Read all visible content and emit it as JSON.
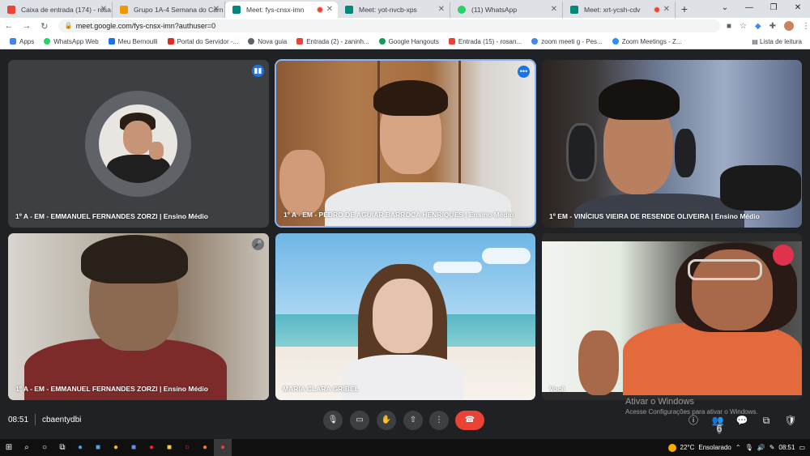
{
  "browser": {
    "tabs": [
      {
        "title": "Caixa de entrada (174) - rosa",
        "favicon_color": "#ea4335",
        "recording": false,
        "active": false
      },
      {
        "title": "Grupo 1A-4 Semana do Carn",
        "favicon_color": "#f29900",
        "recording": false,
        "active": false
      },
      {
        "title": "Meet: fys-cnsx-imn",
        "favicon_color": "#00897b",
        "recording": true,
        "active": true
      },
      {
        "title": "Meet: yot-nvcb-xps",
        "favicon_color": "#00897b",
        "recording": false,
        "active": false
      },
      {
        "title": "(11) WhatsApp",
        "favicon_color": "#25d366",
        "recording": false,
        "active": false
      },
      {
        "title": "Meet: xrt-ycsh-cdv",
        "favicon_color": "#00897b",
        "recording": true,
        "active": false
      }
    ],
    "url": "meet.google.com/fys-cnsx-imn?authuser=0",
    "bookmarks": [
      {
        "label": "Apps",
        "color": "#4285f4"
      },
      {
        "label": "WhatsApp Web",
        "color": "#25d366"
      },
      {
        "label": "Meu Bernoulli",
        "color": "#1a73e8"
      },
      {
        "label": "Portal do Servidor -...",
        "color": "#d93025"
      },
      {
        "label": "Nova guia",
        "color": "#5f6368"
      },
      {
        "label": "Entrada (2) - zaninh...",
        "color": "#ea4335"
      },
      {
        "label": "Google Hangouts",
        "color": "#0f9d58"
      },
      {
        "label": "Entrada (15) - rosan...",
        "color": "#ea4335"
      },
      {
        "label": "zoom meeti g - Pes...",
        "color": "#4285f4"
      },
      {
        "label": "Zoom Meetings - Z...",
        "color": "#2d8cff"
      }
    ],
    "reading_list": "Lista de leitura"
  },
  "participants": [
    {
      "name": "1º A - EM - EMMANUEL FERNANDES ZORZI | Ensino Médio",
      "video": false,
      "speaking": false
    },
    {
      "name": "1º A - EM - PEDRO DE AGUIAR BARROCA HENRIQUES | Ensino Médio",
      "video": true,
      "speaking": true
    },
    {
      "name": "1º EM - VINÍCIUS VIEIRA DE RESENDE OLIVEIRA | Ensino Médio",
      "video": true,
      "speaking": false
    },
    {
      "name": "1º A - EM - EMMANUEL FERNANDES ZORZI | Ensino Médio",
      "video": true,
      "speaking": false
    },
    {
      "name": "MARIA CLARA GRIBEL",
      "video": true,
      "speaking": false
    },
    {
      "name": "Você",
      "video": true,
      "speaking": false
    }
  ],
  "meeting": {
    "time": "08:51",
    "code": "cbaentydbi",
    "participant_count": "6"
  },
  "watermark": {
    "title": "Ativar o Windows",
    "subtitle": "Acesse Configurações para ativar o Windows."
  },
  "taskbar": {
    "temperature": "22°C",
    "weather": "Ensolarado",
    "clock": "08:51"
  }
}
